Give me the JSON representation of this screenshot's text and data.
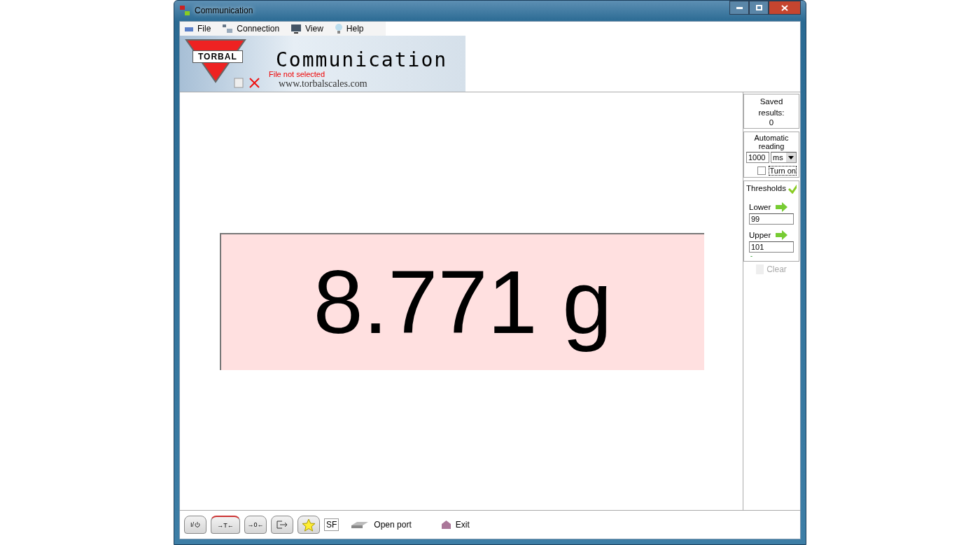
{
  "window": {
    "title": "Communication"
  },
  "menu": [
    "File",
    "Connection",
    "View",
    "Help"
  ],
  "banner": {
    "title": "Communication",
    "logo": "TORBAL",
    "file_status": "File not selected",
    "url": "www.torbalscales.com"
  },
  "display": {
    "reading": "8.771 g"
  },
  "side": {
    "saved_label": "Saved results:",
    "saved_count": "0",
    "auto_label": "Automatic reading",
    "interval": "1000",
    "unit": "ms",
    "turn_on": {
      "label": "Turn on",
      "checked": false
    },
    "thresholds_label": "Thresholds",
    "lower_label": "Lower",
    "lower": "99",
    "upper_label": "Upper",
    "upper": "101",
    "status": "-",
    "clear": "Clear"
  },
  "toolbar": {
    "buttons": [
      {
        "kind": "power",
        "label": "I/"
      },
      {
        "kind": "tare",
        "label": "→T←"
      },
      {
        "kind": "zero",
        "label": "→0←"
      },
      {
        "kind": "export"
      },
      {
        "kind": "star"
      }
    ],
    "sf": "SF",
    "open_port": "Open port",
    "exit": "Exit"
  }
}
